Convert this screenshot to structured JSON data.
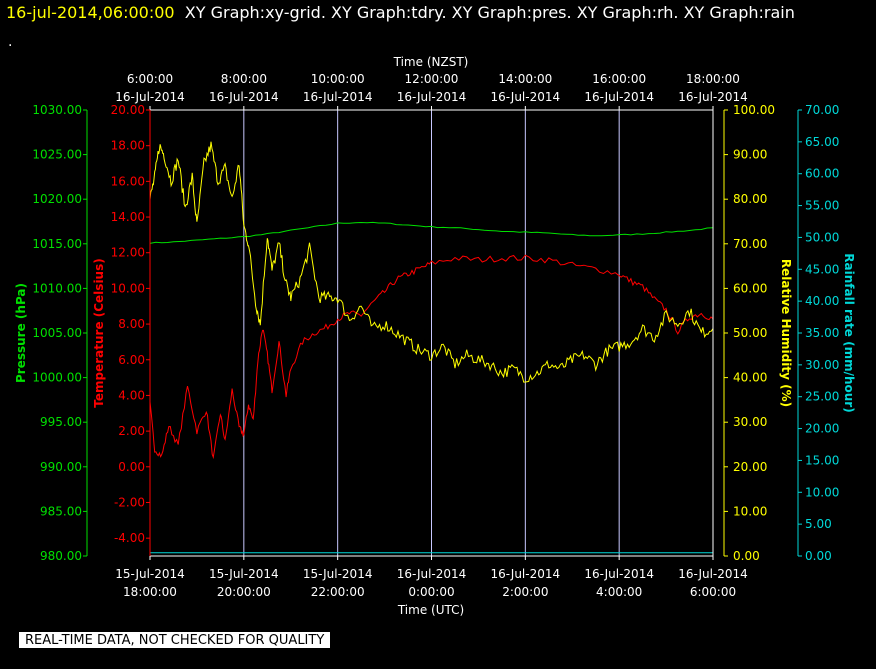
{
  "header": {
    "date_time": "16-jul-2014,06:00:00",
    "graph_titles": "XY Graph:xy-grid.  XY Graph:tdry.  XY Graph:pres.  XY Graph:rh.  XY Graph:rain",
    "dot": "."
  },
  "footer": {
    "disclaimer": "REAL-TIME DATA, NOT CHECKED FOR QUALITY"
  },
  "colors": {
    "background": "#000000",
    "frame": "#ffffff",
    "grid": "#c8c8ff",
    "pressure": "#00e000",
    "temperature": "#ff0000",
    "humidity": "#ffff00",
    "rainfall": "#00d8d8"
  },
  "chart_data": {
    "type": "line",
    "x_top": {
      "title": "Time (NZST)",
      "ticks": [
        {
          "time": "6:00:00",
          "date": "16-Jul-2014"
        },
        {
          "time": "8:00:00",
          "date": "16-Jul-2014"
        },
        {
          "time": "10:00:00",
          "date": "16-Jul-2014"
        },
        {
          "time": "12:00:00",
          "date": "16-Jul-2014"
        },
        {
          "time": "14:00:00",
          "date": "16-Jul-2014"
        },
        {
          "time": "16:00:00",
          "date": "16-Jul-2014"
        },
        {
          "time": "18:00:00",
          "date": "16-Jul-2014"
        }
      ]
    },
    "x_bottom": {
      "title": "Time (UTC)",
      "ticks": [
        {
          "date": "15-Jul-2014",
          "time": "18:00:00"
        },
        {
          "date": "15-Jul-2014",
          "time": "20:00:00"
        },
        {
          "date": "15-Jul-2014",
          "time": "22:00:00"
        },
        {
          "date": "16-Jul-2014",
          "time": "0:00:00"
        },
        {
          "date": "16-Jul-2014",
          "time": "2:00:00"
        },
        {
          "date": "16-Jul-2014",
          "time": "4:00:00"
        },
        {
          "date": "16-Jul-2014",
          "time": "6:00:00"
        }
      ]
    },
    "grid": true,
    "y_axes": [
      {
        "name": "pressure",
        "label": "Pressure (hPa)",
        "range": [
          980,
          1030
        ],
        "ticks": [
          "980.00",
          "985.00",
          "990.00",
          "995.00",
          "1000.00",
          "1005.00",
          "1010.00",
          "1015.00",
          "1020.00",
          "1025.00",
          "1030.00"
        ]
      },
      {
        "name": "temperature",
        "label": "Temperature (Celsius)",
        "range": [
          -5,
          20
        ],
        "ticks": [
          "-4.00",
          "-2.00",
          "0.00",
          "2.00",
          "4.00",
          "6.00",
          "8.00",
          "10.00",
          "12.00",
          "14.00",
          "16.00",
          "18.00",
          "20.00"
        ]
      },
      {
        "name": "humidity",
        "label": "Relative Humidity (%)",
        "range": [
          0,
          100
        ],
        "ticks": [
          "0.00",
          "10.00",
          "20.00",
          "30.00",
          "40.00",
          "50.00",
          "60.00",
          "70.00",
          "80.00",
          "90.00",
          "100.00"
        ]
      },
      {
        "name": "rainfall",
        "label": "Rainfall rate (mm/hour)",
        "range": [
          0,
          70
        ],
        "ticks": [
          "0.00",
          "5.00",
          "10.00",
          "15.00",
          "20.00",
          "25.00",
          "30.00",
          "35.00",
          "40.00",
          "45.00",
          "50.00",
          "55.00",
          "60.00",
          "65.00",
          "70.00"
        ]
      }
    ],
    "series": [
      {
        "name": "pressure",
        "x_hours_utc": [
          18,
          18.5,
          19,
          19.5,
          20,
          20.5,
          21,
          21.5,
          22,
          22.5,
          23,
          23.5,
          24,
          24.5,
          25,
          25.5,
          26,
          26.5,
          27,
          27.5,
          28,
          28.5,
          29,
          29.5,
          30
        ],
        "values": [
          1015.1,
          1015.2,
          1015.4,
          1015.6,
          1015.8,
          1016.1,
          1016.5,
          1016.9,
          1017.3,
          1017.4,
          1017.3,
          1017.1,
          1016.9,
          1016.8,
          1016.6,
          1016.4,
          1016.3,
          1016.2,
          1016.0,
          1015.9,
          1016.0,
          1016.1,
          1016.3,
          1016.5,
          1016.8
        ]
      },
      {
        "name": "temperature",
        "x_hours_utc": [
          18,
          18.1,
          18.25,
          18.4,
          18.6,
          18.8,
          19.0,
          19.2,
          19.35,
          19.5,
          19.6,
          19.75,
          19.9,
          20.0,
          20.1,
          20.2,
          20.3,
          20.4,
          20.5,
          20.6,
          20.75,
          20.9,
          21.0,
          21.25,
          21.5,
          21.75,
          22.0,
          22.25,
          22.5,
          22.75,
          23.0,
          23.25,
          23.5,
          23.75,
          24.0,
          24.5,
          25.0,
          25.5,
          26.0,
          26.5,
          27.0,
          27.5,
          28.0,
          28.25,
          28.5,
          28.75,
          29.0,
          29.25,
          29.5,
          29.75,
          30.0
        ],
        "values": [
          3.5,
          1.0,
          0.6,
          2.3,
          1.2,
          4.5,
          2.0,
          3.2,
          0.4,
          3.0,
          1.4,
          4.3,
          2.2,
          1.8,
          3.5,
          2.6,
          6.0,
          7.8,
          6.3,
          4.3,
          7.0,
          4.0,
          5.5,
          7.0,
          7.5,
          7.8,
          8.3,
          8.6,
          8.5,
          9.2,
          9.8,
          10.5,
          10.8,
          11.1,
          11.4,
          11.7,
          11.6,
          11.7,
          11.7,
          11.6,
          11.3,
          11.1,
          10.8,
          10.4,
          10.1,
          9.4,
          8.8,
          7.6,
          8.4,
          8.6,
          8.3
        ]
      },
      {
        "name": "humidity",
        "x_hours_utc": [
          18,
          18.1,
          18.2,
          18.3,
          18.45,
          18.6,
          18.75,
          18.9,
          19.0,
          19.15,
          19.3,
          19.45,
          19.6,
          19.75,
          19.9,
          20.0,
          20.1,
          20.25,
          20.35,
          20.5,
          20.6,
          20.75,
          20.9,
          21.0,
          21.2,
          21.4,
          21.6,
          21.8,
          22.0,
          22.25,
          22.5,
          22.75,
          23.0,
          23.25,
          23.5,
          23.75,
          24.0,
          24.25,
          24.5,
          24.75,
          25.0,
          25.25,
          25.5,
          25.75,
          26.0,
          26.25,
          26.5,
          26.75,
          27.0,
          27.25,
          27.5,
          27.75,
          28.0,
          28.25,
          28.5,
          28.75,
          29.0,
          29.25,
          29.5,
          29.75,
          30.0
        ],
        "values": [
          80,
          85,
          92,
          90,
          84,
          89,
          78,
          85,
          74,
          88,
          92,
          84,
          87,
          80,
          88,
          74,
          70,
          57,
          52,
          72,
          64,
          70,
          61,
          58,
          62,
          69,
          58,
          58,
          58,
          53,
          56,
          51,
          52,
          50,
          48,
          46,
          45,
          47,
          43,
          45,
          44,
          43,
          41,
          42,
          40,
          41,
          43,
          42,
          44,
          45,
          43,
          46,
          47,
          48,
          51,
          49,
          54,
          52,
          55,
          50,
          51
        ]
      },
      {
        "name": "rainfall",
        "x_hours_utc": [
          18,
          30
        ],
        "values": [
          0.5,
          0.5
        ]
      }
    ]
  }
}
